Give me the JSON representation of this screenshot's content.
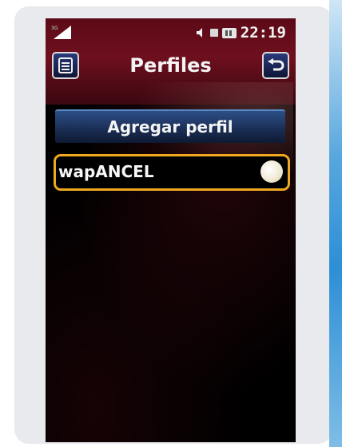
{
  "status_bar": {
    "network_label": "3G",
    "time": "22:19",
    "icons": [
      "signal-icon",
      "speaker-icon",
      "sim-icon",
      "battery-icon"
    ]
  },
  "header": {
    "title": "Perfiles",
    "menu_icon": "menu-icon",
    "back_icon": "back-arrow-icon"
  },
  "actions": {
    "add_profile_label": "Agregar perfil"
  },
  "profiles": [
    {
      "name": "wapANCEL",
      "selected": true
    }
  ],
  "colors": {
    "header_red": "#6e0f1e",
    "highlight_orange": "#f0a820",
    "button_blue": "#1b2f56",
    "background": "#000000",
    "frame": "#e9eaee"
  }
}
